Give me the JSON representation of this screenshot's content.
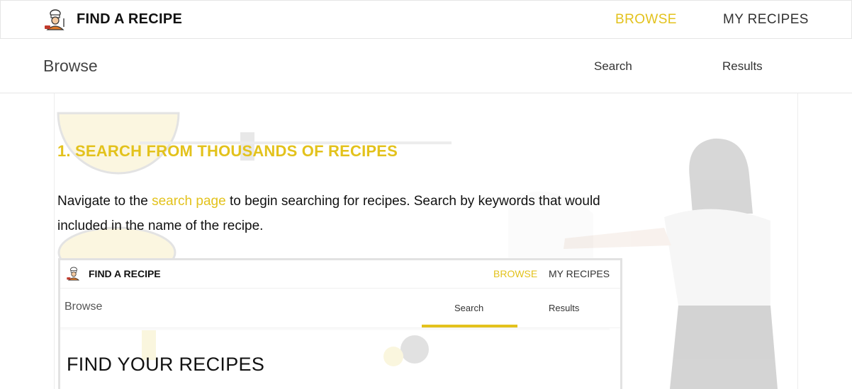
{
  "header": {
    "brand": "FIND A RECIPE",
    "logo_icon": "chef-icon",
    "nav": [
      {
        "label": "BROWSE",
        "active": true
      },
      {
        "label": "MY RECIPES",
        "active": false
      }
    ]
  },
  "subheader": {
    "title": "Browse",
    "tabs": [
      {
        "label": "Search"
      },
      {
        "label": "Results"
      }
    ]
  },
  "content": {
    "step_heading": "1. SEARCH FROM THOUSANDS OF RECIPES",
    "paragraph_prefix": "Navigate to the ",
    "paragraph_link": "search page",
    "paragraph_suffix": " to begin searching for recipes. Search by keywords that would included in the name of the recipe."
  },
  "embedded_screenshot": {
    "brand": "FIND A RECIPE",
    "nav_browse": "BROWSE",
    "nav_my_recipes": "MY RECIPES",
    "subtitle": "Browse",
    "tab_search": "Search",
    "tab_results": "Results",
    "page_title": "FIND YOUR RECIPES"
  },
  "colors": {
    "accent": "#e3c21c",
    "text": "#111111",
    "border": "#e6e6e6"
  }
}
